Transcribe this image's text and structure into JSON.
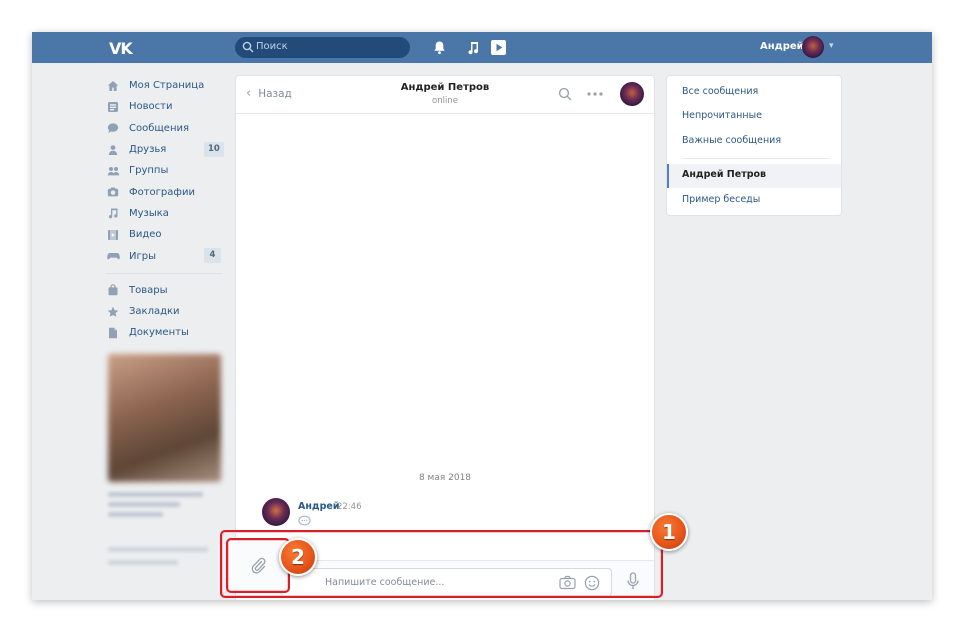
{
  "header": {
    "logo": "VK",
    "search_placeholder": "Поиск",
    "user_name": "Андрей"
  },
  "sidebar": {
    "items": [
      {
        "label": "Моя Страница",
        "icon": "home-icon"
      },
      {
        "label": "Новости",
        "icon": "news-icon"
      },
      {
        "label": "Сообщения",
        "icon": "messages-icon"
      },
      {
        "label": "Друзья",
        "icon": "friends-icon",
        "badge": "10"
      },
      {
        "label": "Группы",
        "icon": "groups-icon"
      },
      {
        "label": "Фотографии",
        "icon": "camera-icon"
      },
      {
        "label": "Музыка",
        "icon": "music-icon"
      },
      {
        "label": "Видео",
        "icon": "video-icon"
      },
      {
        "label": "Игры",
        "icon": "gamepad-icon",
        "badge": "4"
      }
    ],
    "items2": [
      {
        "label": "Товары",
        "icon": "bag-icon"
      },
      {
        "label": "Закладки",
        "icon": "star-icon"
      },
      {
        "label": "Документы",
        "icon": "document-icon"
      }
    ]
  },
  "chat": {
    "back_label": "Назад",
    "contact_name": "Андрей Петров",
    "contact_status": "online",
    "date_separator": "8 мая 2018",
    "message": {
      "author": "Андрей",
      "time": "22:46"
    },
    "input_placeholder": "Напишите сообщение..."
  },
  "right_menu": {
    "items": [
      "Все сообщения",
      "Непрочитанные",
      "Важные сообщения"
    ],
    "dialogs": [
      "Андрей Петров",
      "Пример беседы"
    ]
  },
  "annotations": {
    "callout_1": "1",
    "callout_2": "2"
  },
  "colors": {
    "header_blue": "#4a76a8",
    "link_blue": "#2a5885",
    "highlight_red": "#d5202b",
    "callout_orange": "#e8561b"
  }
}
